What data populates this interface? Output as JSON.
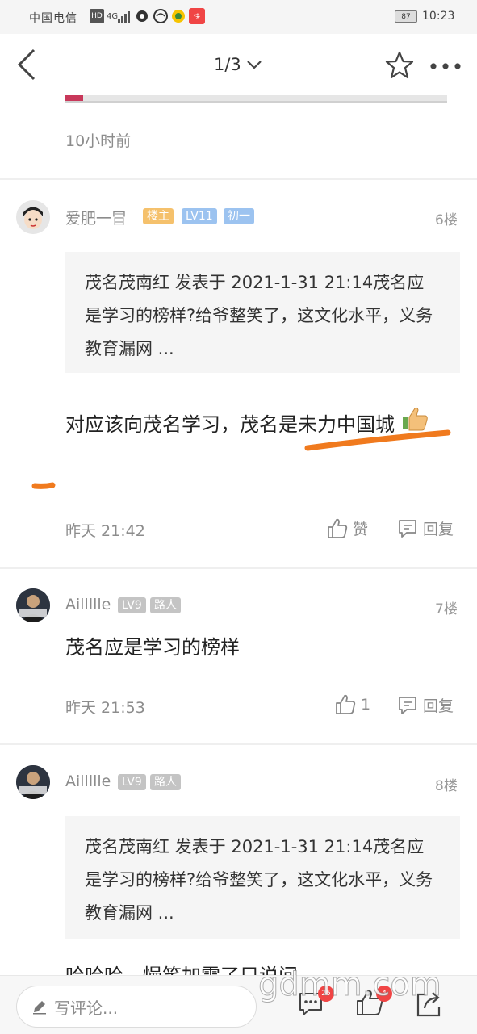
{
  "status_bar": {
    "carrier": "中国电信",
    "hd": "HD",
    "network": "4G",
    "battery": "87",
    "time": "10:23"
  },
  "nav": {
    "page_indicator": "1/3"
  },
  "top_post": {
    "time": "10小时前"
  },
  "posts": [
    {
      "username": "爱肥一冒",
      "badges": [
        {
          "text": "楼主",
          "color": "#f5c16c"
        },
        {
          "text": "LV11",
          "color": "#9cc3f0"
        },
        {
          "text": "初一",
          "color": "#9cc3f0"
        }
      ],
      "floor": "6楼",
      "quote": "茂名茂南红 发表于 2021-1-31 21:14茂名应是学习的榜样?给爷整笑了，这文化水平，义务教育漏网 ...",
      "content": "对应该向茂名学习，茂名是未力中国城",
      "time": "昨天 21:42",
      "like_label": "赞",
      "reply_label": "回复"
    },
    {
      "username": "Aillllle",
      "badges": [
        {
          "text": "LV9",
          "color": "#c4c4c4"
        },
        {
          "text": "路人",
          "color": "#c4c4c4"
        }
      ],
      "floor": "7楼",
      "content": "茂名应是学习的榜样",
      "time": "昨天 21:53",
      "like_label": "1",
      "reply_label": "回复"
    },
    {
      "username": "Aillllle",
      "badges": [
        {
          "text": "LV9",
          "color": "#c4c4c4"
        },
        {
          "text": "路人",
          "color": "#c4c4c4"
        }
      ],
      "floor": "8楼",
      "quote": "茂名茂南红 发表于 2021-1-31 21:14茂名应是学习的榜样?给爷整笑了，这文化水平，义务教育漏网 ...",
      "content_partial": "哈哈哈，慢笑加需了只说问"
    }
  ],
  "bottom_bar": {
    "comment_placeholder": "写评论...",
    "comment_count": "25",
    "like_count": "4",
    "watermark": "gdmm.com"
  },
  "colors": {
    "accent_orange": "#f07a1e",
    "badge_red": "#f04545"
  }
}
